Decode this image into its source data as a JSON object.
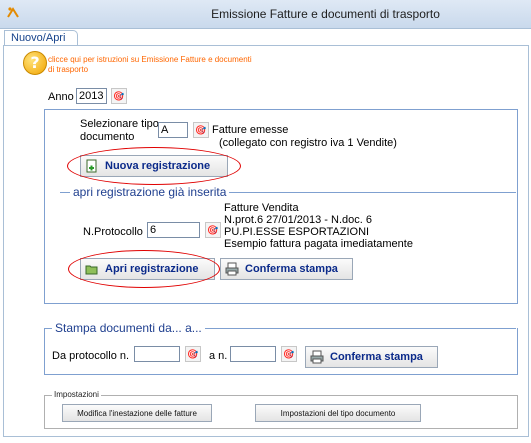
{
  "window": {
    "title": "Emissione Fatture e documenti di trasporto"
  },
  "tabs": [
    {
      "label": "Nuovo/Apri"
    }
  ],
  "help": {
    "text": "clicce qui per istruzioni su Emissione Fatture e documenti di trasporto"
  },
  "anno": {
    "label": "Anno",
    "value": "2013"
  },
  "tipo": {
    "label_line1": "Selezionare tipo",
    "label_line2": "documento",
    "value": "A",
    "desc1": "Fatture emesse",
    "desc2": "(collegato con registro iva 1 Vendite)",
    "new_button": "Nuova registrazione"
  },
  "apri": {
    "title": "apri registrazione già inserita",
    "protocollo_label": "N.Protocollo",
    "protocollo_value": "6",
    "info": [
      "Fatture Vendita",
      "N.prot.6 27/01/2013 - N.doc. 6",
      "PU.PI.ESSE ESPORTAZIONI",
      "Esempio fattura pagata imediatamente"
    ],
    "open_button": "Apri registrazione",
    "print_button": "Conferma stampa"
  },
  "stampa": {
    "title": "Stampa documenti da... a...",
    "from_label": "Da protocollo n.",
    "from_value": "",
    "to_label": "a n.",
    "to_value": "",
    "print_button": "Conferma stampa"
  },
  "impostazioni": {
    "title": "Impostazioni",
    "btn_intestazione": "Modifica l'inestazione delle fatture",
    "btn_tipo": "Impostazioni del tipo documento"
  },
  "colors": {
    "accent": "#0b2a8a",
    "group_border": "#7fa0d0",
    "highlight": "#e00000",
    "help_text": "#ff6600"
  }
}
